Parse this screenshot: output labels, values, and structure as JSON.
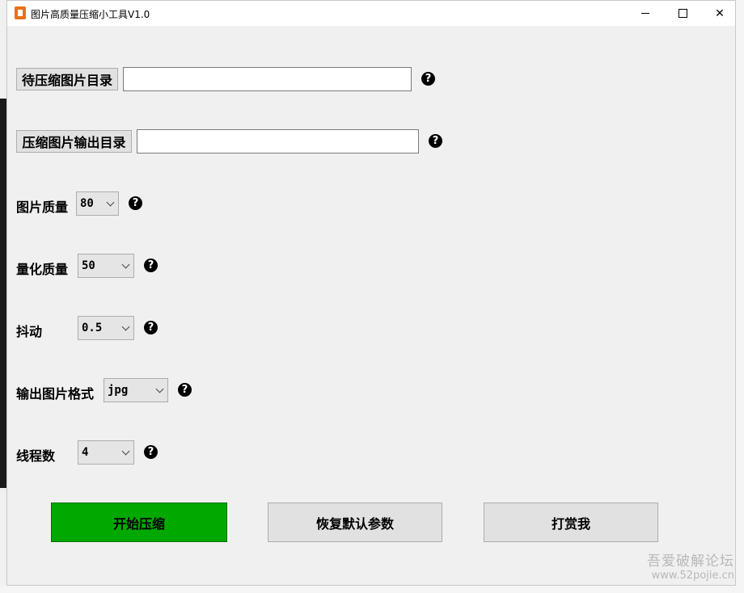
{
  "window": {
    "title": "图片高质量压缩小工具V1.0",
    "controls": {
      "minimize": "",
      "maximize": "",
      "close": "✕"
    }
  },
  "rows": {
    "input_dir": {
      "button_label": "待压缩图片目录",
      "value": "",
      "help": "?"
    },
    "output_dir": {
      "button_label": "压缩图片输出目录",
      "value": "",
      "help": "?"
    },
    "image_quality": {
      "label": "图片质量",
      "value": "80",
      "help": "?"
    },
    "quantize_quality": {
      "label": "量化质量",
      "value": "50",
      "help": "?"
    },
    "dither": {
      "label": "抖动",
      "value": "0.5",
      "help": "?"
    },
    "output_format": {
      "label": "输出图片格式",
      "value": "jpg",
      "help": "?"
    },
    "threads": {
      "label": "线程数",
      "value": "4",
      "help": "?"
    }
  },
  "actions": {
    "start": "开始压缩",
    "reset": "恢复默认参数",
    "reward": "打赏我"
  },
  "watermark": {
    "line1": "吾爱破解论坛",
    "line2": "www.52pojie.cn"
  },
  "colors": {
    "start_button": "#00a800",
    "window_bg": "#f0f0f0",
    "help_icon": "#000000"
  },
  "icons": {
    "app": "app-icon",
    "help": "help-icon",
    "dropdown": "chevron-down-icon"
  }
}
